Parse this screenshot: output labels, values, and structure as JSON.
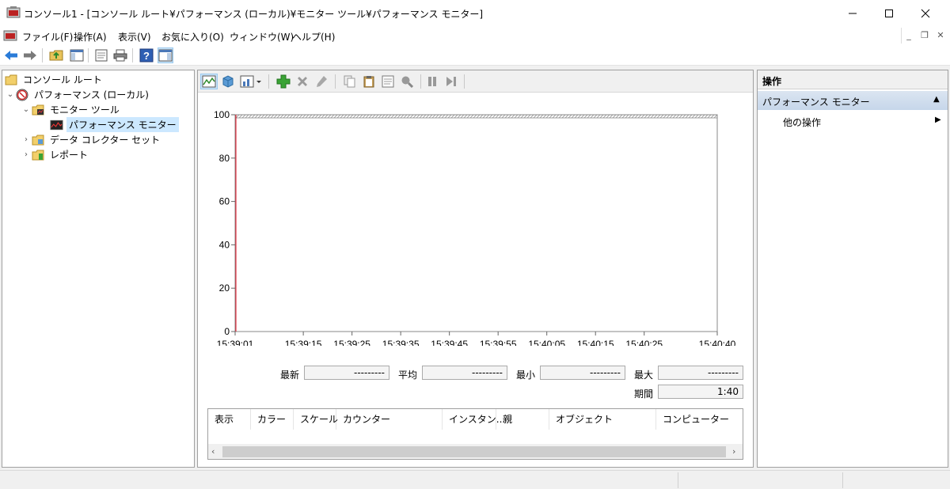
{
  "window": {
    "title": "コンソール1 - [コンソール ルート¥パフォーマンス (ローカル)¥モニター ツール¥パフォーマンス モニター]",
    "minimize_glyph": "—",
    "maximize_glyph": "☐",
    "close_glyph": "✕"
  },
  "menu": {
    "items": [
      "ファイル(F)",
      "操作(A)",
      "表示(V)",
      "お気に入り(O)",
      "ウィンドウ(W)",
      "ヘルプ(H)"
    ]
  },
  "toolbar": {
    "icons": [
      "back-icon",
      "forward-icon",
      "up-folder-icon",
      "show-tree-icon",
      "properties-icon",
      "print-icon",
      "help-icon",
      "show-action-pane-icon"
    ]
  },
  "tree": {
    "nodes": [
      {
        "label": "コンソール ルート",
        "icon": "folder-icon",
        "level": 0,
        "expander": ""
      },
      {
        "label": "パフォーマンス (ローカル)",
        "icon": "performance-icon",
        "level": 1,
        "expander": "⌄"
      },
      {
        "label": "モニター ツール",
        "icon": "folder-monitor-icon",
        "level": 2,
        "expander": "⌄"
      },
      {
        "label": "パフォーマンス モニター",
        "icon": "performance-monitor-icon",
        "level": 3,
        "expander": "",
        "selected": true
      },
      {
        "label": "データ コレクター セット",
        "icon": "data-collector-icon",
        "level": 2,
        "expander": "›"
      },
      {
        "label": "レポート",
        "icon": "report-icon",
        "level": 2,
        "expander": "›"
      }
    ]
  },
  "chart_data": {
    "type": "line",
    "title": "",
    "xlabel": "",
    "ylabel": "",
    "x_ticks": [
      "15:39:01",
      "15:39:15",
      "15:39:25",
      "15:39:35",
      "15:39:45",
      "15:39:55",
      "15:40:05",
      "15:40:15",
      "15:40:25",
      "15:40:40"
    ],
    "x_tick_seconds": [
      0,
      14,
      24,
      34,
      44,
      54,
      64,
      74,
      84,
      99
    ],
    "y_ticks": [
      0,
      20,
      40,
      60,
      80,
      100
    ],
    "ylim": [
      0,
      100
    ],
    "series": [],
    "grid": false,
    "cursor_color": "#e81123"
  },
  "stats": {
    "latest_label": "最新",
    "latest_value": "---------",
    "average_label": "平均",
    "average_value": "---------",
    "min_label": "最小",
    "min_value": "---------",
    "max_label": "最大",
    "max_value": "---------",
    "duration_label": "期間",
    "duration_value": "1:40"
  },
  "counter_table": {
    "columns": [
      "表示",
      "カラー",
      "スケール",
      "カウンター",
      "インスタン...",
      "親",
      "オブジェクト",
      "コンピューター"
    ],
    "rows": []
  },
  "actions": {
    "header": "操作",
    "section_title": "パフォーマンス モニター",
    "section_arrow": "▲",
    "items": [
      {
        "label": "他の操作",
        "arrow": "▶"
      }
    ]
  }
}
